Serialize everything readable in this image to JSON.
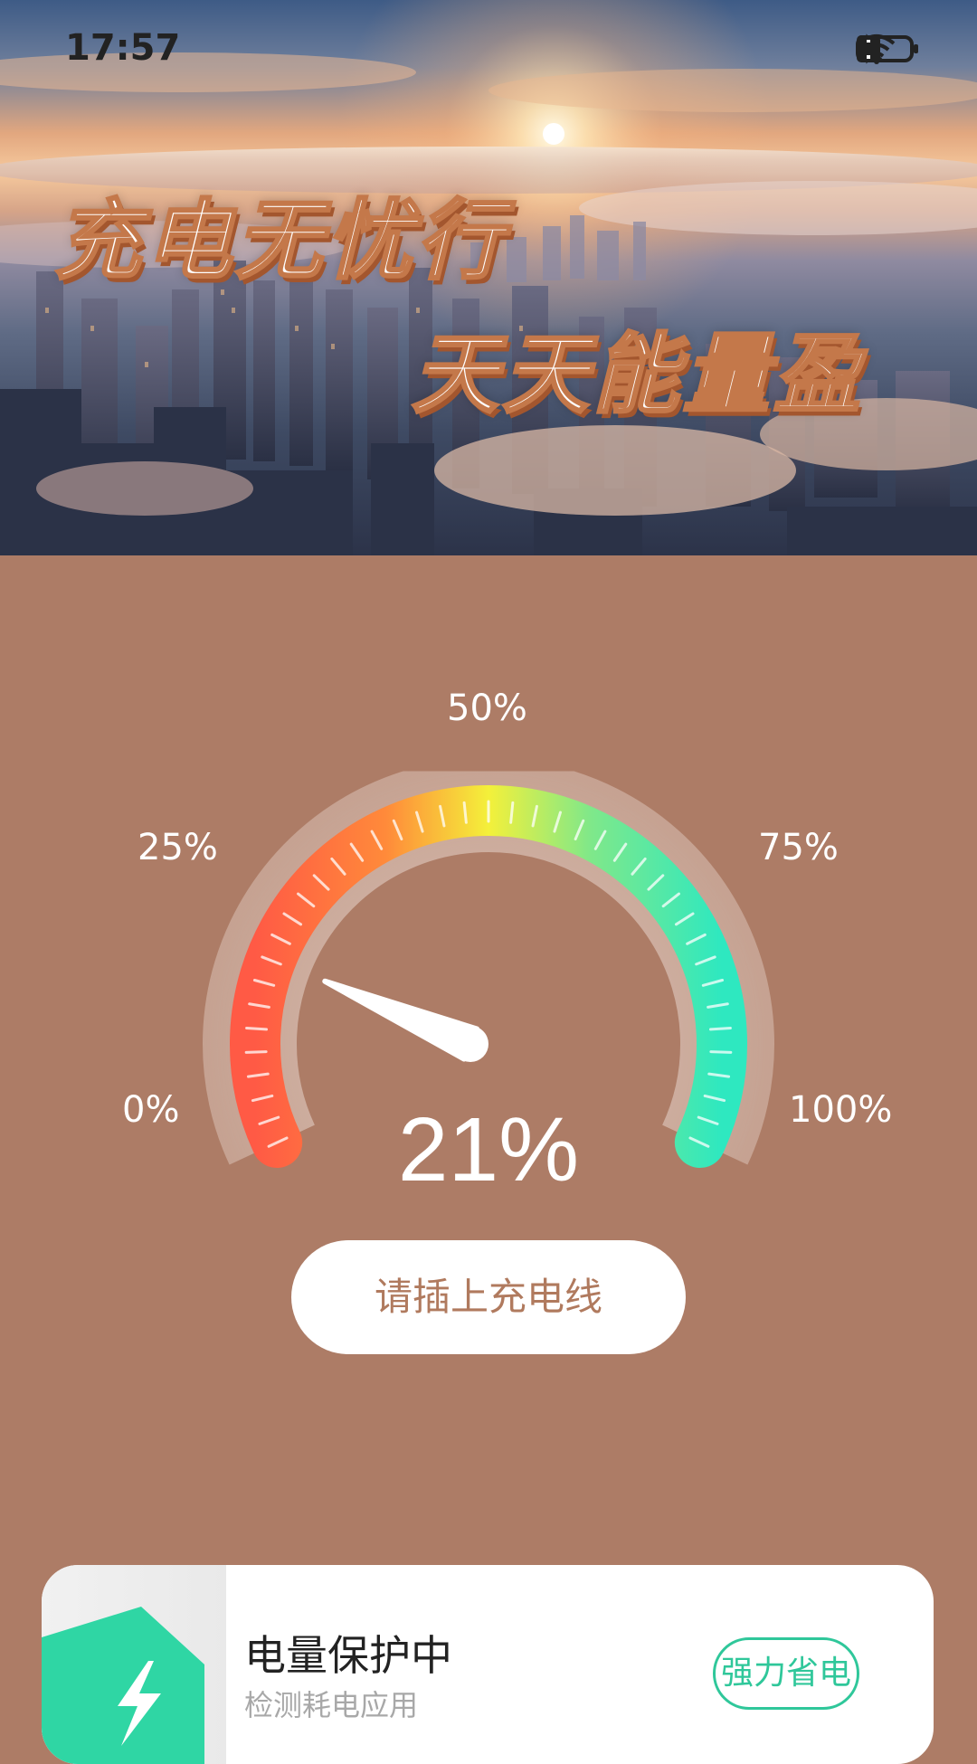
{
  "status_bar": {
    "time": "17:57",
    "icons": [
      "bluetooth-icon",
      "bell-off-icon",
      "wifi-icon",
      "alert-icon",
      "battery-icon"
    ]
  },
  "hero": {
    "line1": "充电无忧行",
    "line2": "天天能量盈"
  },
  "gauge": {
    "labels": {
      "p0": "0%",
      "p25": "25%",
      "p50": "50%",
      "p75": "75%",
      "p100": "100%"
    },
    "level": 21,
    "level_text": "21%",
    "colors": {
      "low": "#ff5a45",
      "mid": "#f4f03a",
      "high": "#2ee8c0"
    }
  },
  "charge_prompt": "请插上充电线",
  "card": {
    "title": "电量保护中",
    "subtitle": "检测耗电应用",
    "button": "强力省电",
    "accent": "#2fc79a"
  }
}
